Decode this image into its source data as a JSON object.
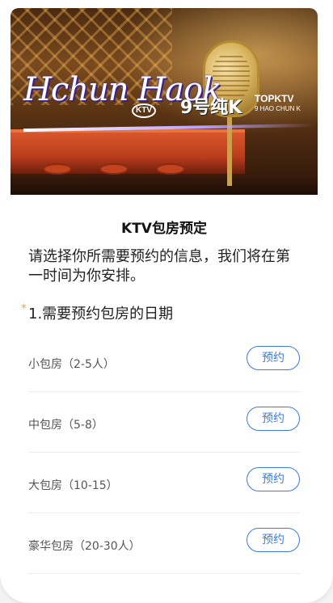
{
  "banner": {
    "logo_text": "Hchun Haok",
    "logo_badge": "KTV",
    "slogan": "9号纯K",
    "brand_top": "TOPKTV",
    "brand_sub": "9 HAO CHUN K"
  },
  "page": {
    "title": "KTV包房预定",
    "description": "请选择你所需要预约的信息，我们将在第一时间为你安排。",
    "question_required_mark": "*",
    "question": "1.需要预约包房的日期"
  },
  "rooms": [
    {
      "name": "小包房（2-5人）",
      "button": "预约"
    },
    {
      "name": "中包房（5-8）",
      "button": "预约"
    },
    {
      "name": "大包房（10-15）",
      "button": "预约"
    },
    {
      "name": "豪华包房（20-30人）",
      "button": "预约"
    }
  ],
  "colors": {
    "accent": "#3a7be0",
    "required": "#f2a83a"
  }
}
